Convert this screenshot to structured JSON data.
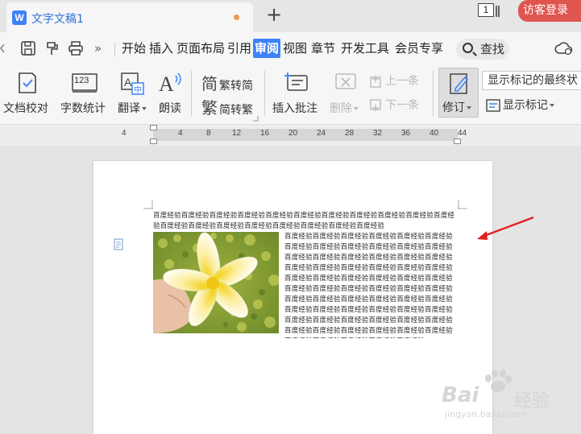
{
  "tab": {
    "title": "文字文稿1",
    "logo": "W",
    "new_tab": "+"
  },
  "titlebar": {
    "window_count": "1",
    "visitor_login": "访客登录"
  },
  "menu": {
    "items": [
      "开始",
      "插入",
      "页面布局",
      "引用",
      "审阅",
      "视图",
      "章节",
      "开发工具",
      "会员专享"
    ],
    "active": "审阅",
    "search": "查找",
    "more": "»"
  },
  "ribbon": {
    "proofread": "文档校对",
    "word_count": "字数统计",
    "translate": "翻译",
    "read_aloud": "朗读",
    "trad_simp": "繁转简",
    "simp_trad": "简转繁",
    "trad_glyph": "简",
    "simp_glyph": "繁",
    "insert_comment": "插入批注",
    "delete": "删除",
    "prev": "上一条",
    "next": "下一条",
    "revise": "修订",
    "display_markup_select": "显示标记的最终状",
    "display_markup": "显示标记",
    "icon_text_word_count": "123"
  },
  "ruler": {
    "ticks": [
      "4",
      "4",
      "8",
      "12",
      "16",
      "20",
      "24",
      "28",
      "32",
      "36",
      "40",
      "44"
    ]
  },
  "document": {
    "header_text": "百度经验百度经验百度经验百度经验百度经验百度经验百度经验百度经验百度经验百度经验百度经验百度经验百度经验百度经验百度经验百度经验百度经验百度经验百度经验",
    "wrap_text": "百度经验百度经验百度经验百度经验百度经验百度经验百度经验百度经验百度经验百度经验百度经验百度经验百度经验百度经验百度经验百度经验百度经验百度经验百度经验百度经验百度经验百度经验百度经验百度经验百度经验百度经验百度经验百度经验百度经验百度经验百度经验百度经验百度经验百度经验百度经验百度经验百度经验百度经验百度经验百度经验百度经验百度经验百度经验百度经验百度经验百度经验百度经验百度经验百度经验百度经验百度经验百度经验百度经验百度经验百度经验百度经验百度经验百度经验百度经验百度经验百度经验百度经验百度经验百度经验百度经验"
  },
  "watermark": {
    "brand": "Bai",
    "brand_cn": "经验",
    "url": "jingyan.baidu.com"
  },
  "colors": {
    "accent": "#3e82f7",
    "visitor": "#e0544f",
    "arrow": "#e02020"
  }
}
